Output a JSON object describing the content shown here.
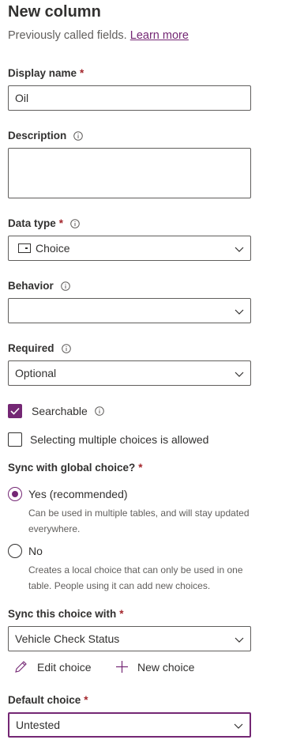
{
  "header": {
    "title": "New column",
    "subtitle": "Previously called fields.",
    "learn_more": "Learn more"
  },
  "display_name": {
    "label": "Display name",
    "required": "*",
    "value": "Oil"
  },
  "description": {
    "label": "Description",
    "value": ""
  },
  "data_type": {
    "label": "Data type",
    "required": "*",
    "value": "Choice",
    "icon": "choice-type-icon"
  },
  "behavior": {
    "label": "Behavior",
    "value": ""
  },
  "required": {
    "label": "Required",
    "value": "Optional"
  },
  "searchable": {
    "label": "Searchable",
    "checked": true
  },
  "multiple": {
    "label": "Selecting multiple choices is allowed",
    "checked": false
  },
  "sync_global": {
    "label": "Sync with global choice?",
    "required": "*",
    "yes_label": "Yes (recommended)",
    "yes_desc": "Can be used in multiple tables, and will stay updated everywhere.",
    "no_label": "No",
    "no_desc": "Creates a local choice that can only be used in one table. People using it can add new choices.",
    "selected": "yes"
  },
  "sync_choice": {
    "label": "Sync this choice with",
    "required": "*",
    "value": "Vehicle Check Status"
  },
  "choice_actions": {
    "edit": "Edit choice",
    "new": "New choice"
  },
  "default_choice": {
    "label": "Default choice",
    "required": "*",
    "value": "Untested"
  },
  "colors": {
    "accent": "#742774",
    "required": "#a4262c",
    "border": "#605e5c"
  }
}
